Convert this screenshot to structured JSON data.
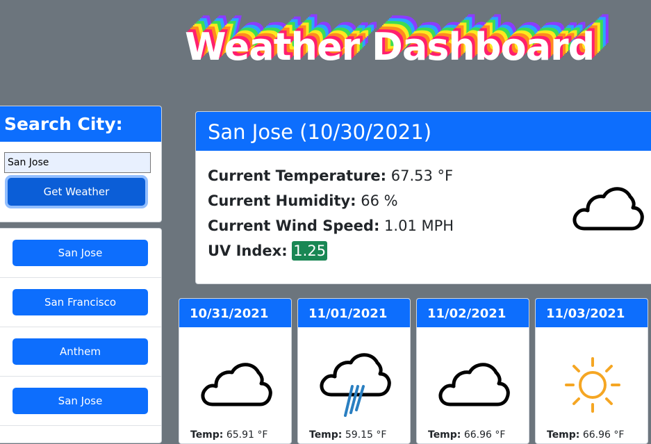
{
  "header": {
    "title": "Weather Dashboard"
  },
  "search": {
    "heading": "Search City:",
    "input_value": "San Jose",
    "button_label": "Get Weather"
  },
  "history": {
    "items": [
      {
        "label": "San Jose"
      },
      {
        "label": "San Francisco"
      },
      {
        "label": "Anthem"
      },
      {
        "label": "San Jose"
      }
    ]
  },
  "current": {
    "heading": "San Jose (10/30/2021)",
    "temperature_label": "Current Temperature:",
    "temperature_value": "67.53 °F",
    "humidity_label": "Current Humidity:",
    "humidity_value": "66 %",
    "wind_label": "Current Wind Speed:",
    "wind_value": "1.01 MPH",
    "uv_label": "UV Index:",
    "uv_value": "1.25",
    "uv_color": "#198754",
    "icon": "cloud-icon"
  },
  "forecast": [
    {
      "date": "10/31/2021",
      "icon": "cloud-icon",
      "temp_label": "Temp:",
      "temp_value": "65.91 °F"
    },
    {
      "date": "11/01/2021",
      "icon": "rain-cloud-icon",
      "temp_label": "Temp:",
      "temp_value": "59.15 °F"
    },
    {
      "date": "11/02/2021",
      "icon": "cloud-icon",
      "temp_label": "Temp:",
      "temp_value": "66.96 °F"
    },
    {
      "date": "11/03/2021",
      "icon": "sun-icon",
      "temp_label": "Temp:",
      "temp_value": "66.96 °F"
    }
  ],
  "colors": {
    "page_background": "#6c757d",
    "primary": "#0d6efd",
    "primary_active": "#0b5ed7",
    "sun": "#f5a623",
    "rain": "#2a7fc1"
  }
}
